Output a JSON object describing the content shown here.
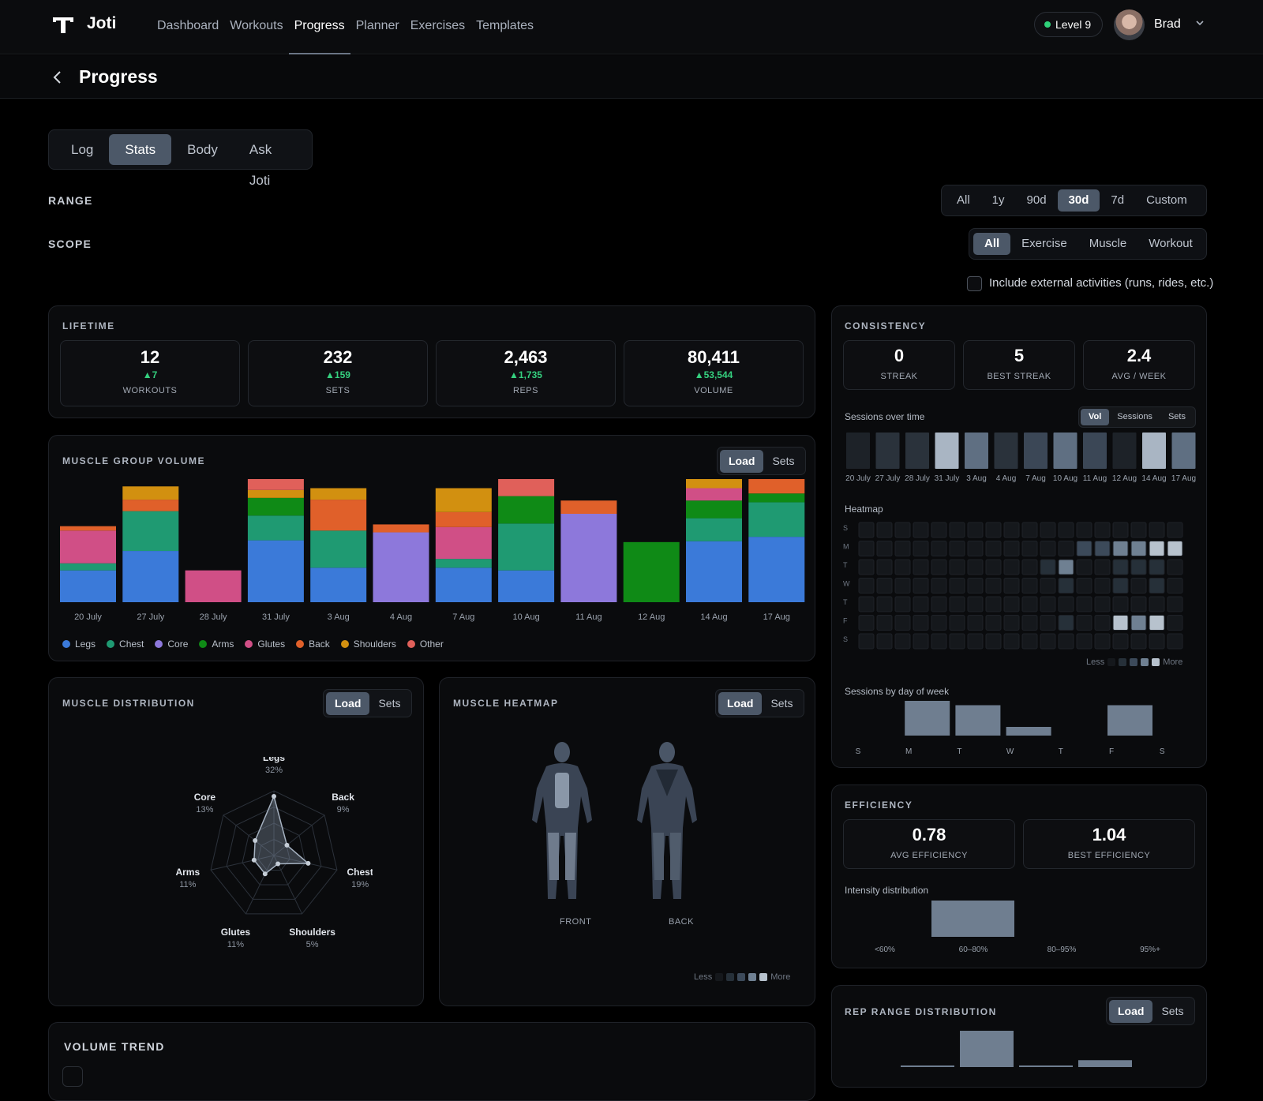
{
  "app": {
    "name": "Joti",
    "level": "Level 9",
    "user": "Brad"
  },
  "nav": [
    "Dashboard",
    "Workouts",
    "Progress",
    "Planner",
    "Exercises",
    "Templates"
  ],
  "page": {
    "title": "Progress",
    "tabs": [
      "Log",
      "Stats",
      "Body",
      "Ask Joti"
    ],
    "active_tab": "Stats"
  },
  "range": {
    "label": "RANGE",
    "options": [
      "All",
      "1y",
      "90d",
      "30d",
      "7d",
      "Custom"
    ],
    "selected": "30d"
  },
  "scope": {
    "label": "SCOPE",
    "options": [
      "All",
      "Exercise",
      "Muscle",
      "Workout"
    ],
    "selected": "All"
  },
  "external": {
    "label": "Include external activities (runs, rides, etc.)",
    "checked": false
  },
  "lifetime": {
    "title": "LIFETIME",
    "stats": [
      {
        "value": "12",
        "delta": "7",
        "label": "WORKOUTS"
      },
      {
        "value": "232",
        "delta": "159",
        "label": "SETS"
      },
      {
        "value": "2,463",
        "delta": "1,735",
        "label": "REPS"
      },
      {
        "value": "80,411",
        "delta": "53,544",
        "label": "VOLUME"
      }
    ]
  },
  "muscle_group_volume": {
    "title": "MUSCLE GROUP VOLUME",
    "toggle": [
      "Load",
      "Sets"
    ],
    "selected": "Load"
  },
  "consistency": {
    "title": "CONSISTENCY",
    "stats": [
      {
        "value": "0",
        "label": "STREAK"
      },
      {
        "value": "5",
        "label": "BEST STREAK"
      },
      {
        "value": "2.4",
        "label": "AVG / WEEK"
      }
    ],
    "sessions_label": "Sessions over time",
    "sessions_toggle": [
      "Vol",
      "Sessions",
      "Sets"
    ],
    "sessions_selected": "Vol",
    "heatmap_label": "Heatmap",
    "heatmap_rows": [
      "S",
      "M",
      "T",
      "W",
      "T",
      "F",
      "S"
    ],
    "less": "Less",
    "more": "More",
    "dow_label": "Sessions by day of week"
  },
  "muscle_distribution": {
    "title": "MUSCLE DISTRIBUTION",
    "toggle": [
      "Load",
      "Sets"
    ],
    "selected": "Load"
  },
  "muscle_heatmap": {
    "title": "MUSCLE HEATMAP",
    "toggle": [
      "Load",
      "Sets"
    ],
    "selected": "Load",
    "front": "FRONT",
    "back": "BACK",
    "less": "Less",
    "more": "More"
  },
  "efficiency": {
    "title": "EFFICIENCY",
    "stats": [
      {
        "value": "0.78",
        "label": "AVG EFFICIENCY"
      },
      {
        "value": "1.04",
        "label": "BEST EFFICIENCY"
      }
    ],
    "intensity_label": "Intensity distribution"
  },
  "rep_range": {
    "title": "REP RANGE DISTRIBUTION",
    "toggle": [
      "Load",
      "Sets"
    ],
    "selected": "Load"
  },
  "volume_trend": {
    "title": "VOLUME TREND"
  },
  "colors": {
    "Legs": "#3b7ad9",
    "Chest": "#1f9a72",
    "Core": "#8d78db",
    "Arms": "#0f8a16",
    "Glutes": "#d04f86",
    "Back": "#e0602a",
    "Shoulders": "#d29010",
    "Other": "#e0605a",
    "accent": "#4c5868",
    "positive": "#35d07f"
  },
  "chart_data": [
    {
      "type": "bar",
      "stacked": true,
      "title": "MUSCLE GROUP VOLUME",
      "categories": [
        "20 July",
        "27 July",
        "28 July",
        "31 July",
        "3 Aug",
        "4 Aug",
        "7 Aug",
        "10 Aug",
        "11 Aug",
        "12 Aug",
        "14 Aug",
        "17 Aug"
      ],
      "series": [
        {
          "name": "Legs",
          "values": [
            36,
            58,
            0,
            70,
            39,
            0,
            39,
            36,
            0,
            0,
            69,
            74
          ]
        },
        {
          "name": "Chest",
          "values": [
            8,
            45,
            0,
            28,
            42,
            0,
            10,
            53,
            0,
            0,
            26,
            39
          ]
        },
        {
          "name": "Core",
          "values": [
            0,
            0,
            0,
            0,
            0,
            79,
            0,
            0,
            100,
            0,
            0,
            0
          ]
        },
        {
          "name": "Arms",
          "values": [
            0,
            0,
            0,
            20,
            0,
            0,
            0,
            31,
            0,
            68,
            20,
            10
          ]
        },
        {
          "name": "Glutes",
          "values": [
            37,
            0,
            36,
            0,
            0,
            0,
            36,
            0,
            0,
            0,
            14,
            0
          ]
        },
        {
          "name": "Back",
          "values": [
            5,
            13,
            0,
            0,
            35,
            9,
            17,
            0,
            15,
            0,
            0,
            18
          ]
        },
        {
          "name": "Shoulders",
          "values": [
            0,
            15,
            0,
            9,
            13,
            0,
            27,
            0,
            0,
            0,
            13,
            0
          ]
        },
        {
          "name": "Other",
          "values": [
            0,
            0,
            0,
            18,
            0,
            0,
            0,
            23,
            0,
            0,
            0,
            0
          ]
        }
      ],
      "legend": "bottom-left"
    },
    {
      "type": "bar",
      "title": "Sessions over time",
      "categories": [
        "20 July",
        "27 July",
        "28 July",
        "31 July",
        "3 Aug",
        "4 Aug",
        "7 Aug",
        "10 Aug",
        "11 Aug",
        "12 Aug",
        "14 Aug",
        "17 Aug"
      ],
      "values": [
        0.0,
        0.18,
        0.08,
        0.9,
        0.55,
        0.05,
        0.25,
        0.6,
        0.2,
        0.02,
        0.95,
        0.65
      ]
    },
    {
      "type": "heatmap",
      "title": "Heatmap",
      "rows": [
        "S",
        "M",
        "T",
        "W",
        "T",
        "F",
        "S"
      ],
      "grid": [
        [
          0,
          0,
          0,
          0,
          0,
          0,
          0,
          0,
          0,
          0,
          0,
          0,
          0,
          0,
          0,
          0,
          0,
          0
        ],
        [
          0,
          0,
          0,
          0,
          0,
          0,
          0,
          0,
          0,
          0,
          0,
          0,
          2,
          2,
          3,
          3,
          4,
          4
        ],
        [
          0,
          0,
          0,
          0,
          0,
          0,
          0,
          0,
          0,
          0,
          1,
          3,
          0,
          0,
          1,
          1,
          1,
          0
        ],
        [
          0,
          0,
          0,
          0,
          0,
          0,
          0,
          0,
          0,
          0,
          0,
          1,
          0,
          0,
          1,
          0,
          1,
          0
        ],
        [
          0,
          0,
          0,
          0,
          0,
          0,
          0,
          0,
          0,
          0,
          0,
          0,
          0,
          0,
          0,
          0,
          0,
          0
        ],
        [
          0,
          0,
          0,
          0,
          0,
          0,
          0,
          0,
          0,
          0,
          0,
          1,
          0,
          0,
          4,
          3,
          4,
          0
        ],
        [
          0,
          0,
          0,
          0,
          0,
          0,
          0,
          0,
          0,
          0,
          0,
          0,
          0,
          0,
          0,
          0,
          0,
          0
        ]
      ]
    },
    {
      "type": "bar",
      "title": "Sessions by day of week",
      "categories": [
        "S",
        "M",
        "T",
        "W",
        "T",
        "F",
        "S"
      ],
      "values": [
        0,
        4,
        3.5,
        1,
        0,
        3.5,
        0
      ]
    },
    {
      "type": "radar",
      "title": "MUSCLE DISTRIBUTION",
      "categories": [
        "Legs",
        "Back",
        "Chest",
        "Shoulders",
        "Glutes",
        "Arms",
        "Core"
      ],
      "values": [
        32,
        9,
        19,
        5,
        11,
        11,
        13
      ],
      "labels": [
        "32%",
        "9%",
        "19%",
        "5%",
        "11%",
        "11%",
        "13%"
      ]
    },
    {
      "type": "bar",
      "title": "Intensity distribution",
      "categories": [
        "<60%",
        "60–80%",
        "80–95%",
        "95%+"
      ],
      "values": [
        0,
        1,
        0,
        0
      ]
    },
    {
      "type": "bar",
      "title": "REP RANGE DISTRIBUTION",
      "values": [
        0.03,
        1,
        0.04,
        0.19
      ]
    }
  ]
}
